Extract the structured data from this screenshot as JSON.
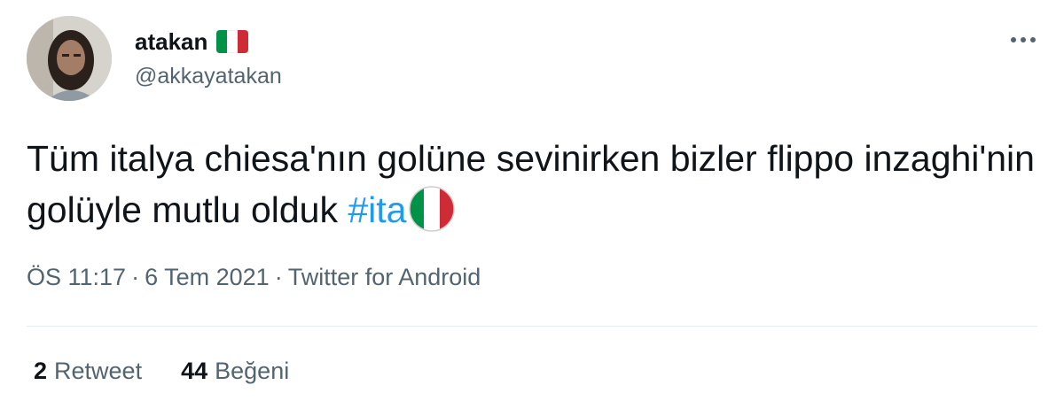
{
  "user": {
    "display_name": "atakan",
    "handle": "@akkayatakan",
    "name_flag_icon": "italy-flag-icon"
  },
  "tweet": {
    "text_main": "Tüm italya chiesa'nın golüne sevinirken bizler flippo inzaghi'nin golüyle mutlu olduk ",
    "hashtag": "#ita",
    "emoji_icon": "italy-flag-emoji-icon"
  },
  "meta": {
    "time": "ÖS 11:17",
    "separator": "·",
    "date": "6 Tem 2021",
    "source": "Twitter for Android"
  },
  "stats": {
    "retweet_count": "2",
    "retweet_label": "Retweet",
    "like_count": "44",
    "like_label": "Beğeni"
  },
  "colors": {
    "text": "#0f1419",
    "secondary": "#536471",
    "link": "#1d9bf0",
    "divider": "#e6ecf0",
    "flag_green": "#009246",
    "flag_white": "#ffffff",
    "flag_red": "#ce2b37"
  }
}
